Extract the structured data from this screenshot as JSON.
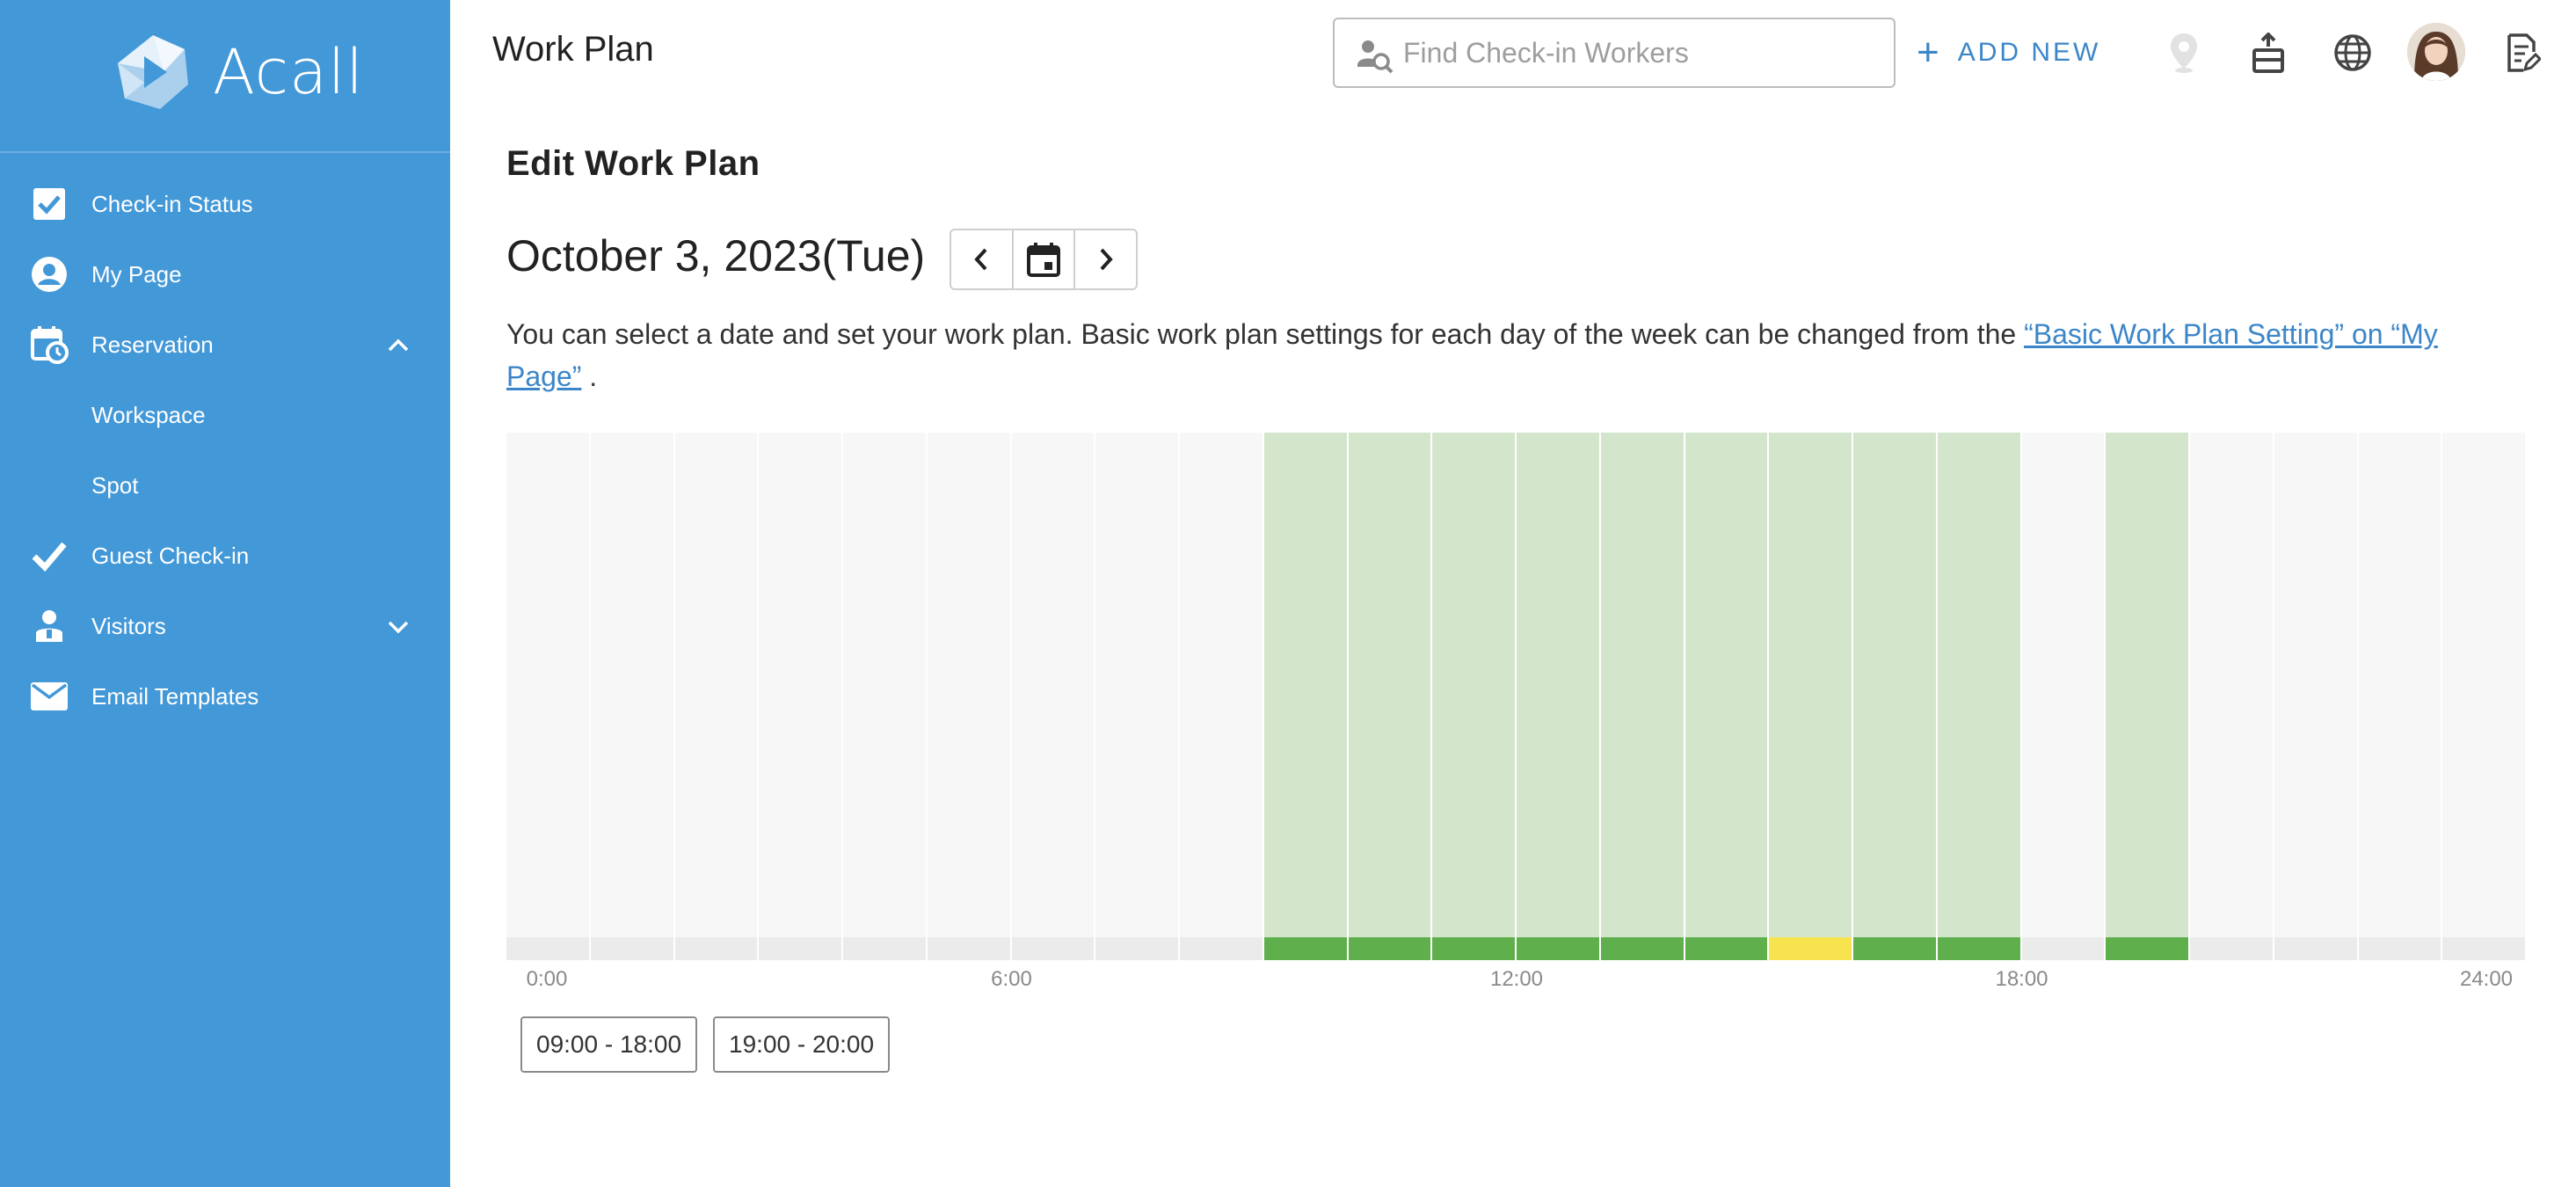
{
  "app": {
    "name": "Acall"
  },
  "sidebar": {
    "items": [
      {
        "label": "Check-in Status",
        "icon": "checkbox-icon"
      },
      {
        "label": "My Page",
        "icon": "user-circle-icon"
      },
      {
        "label": "Reservation",
        "icon": "calendar-clock-icon",
        "expanded": true
      },
      {
        "label": "Workspace",
        "icon": ""
      },
      {
        "label": "Spot",
        "icon": ""
      },
      {
        "label": "Guest Check-in",
        "icon": "checkmark-icon"
      },
      {
        "label": "Visitors",
        "icon": "visitor-icon",
        "expanded": false
      },
      {
        "label": "Email Templates",
        "icon": "envelope-icon"
      }
    ]
  },
  "header": {
    "title": "Work Plan",
    "search_placeholder": "Find Check-in Workers",
    "add_new_label": "ADD NEW",
    "icons": [
      "location-pin-icon",
      "inbox-tray-icon",
      "globe-icon",
      "avatar",
      "edit-document-icon"
    ]
  },
  "main": {
    "section_title": "Edit Work Plan",
    "date": "October 3, 2023(Tue)",
    "description_prefix": "You can select a date and set your work plan. Basic work plan settings for each day of the week can be changed from the ",
    "description_link": "“Basic Work Plan Setting” on “My Page”",
    "description_suffix": " .",
    "timeline": {
      "slots": [
        "",
        "",
        "",
        "",
        "",
        "",
        "",
        "",
        "",
        "planned",
        "planned",
        "planned",
        "planned",
        "planned",
        "planned",
        "planned-alt",
        "planned",
        "planned",
        "",
        "planned",
        "",
        "",
        "",
        ""
      ],
      "tick_labels": [
        {
          "hour": 0,
          "label": "0:00"
        },
        {
          "hour": 6,
          "label": "6:00"
        },
        {
          "hour": 12,
          "label": "12:00"
        },
        {
          "hour": 18,
          "label": "18:00"
        },
        {
          "hour": 24,
          "label": "24:00"
        }
      ]
    },
    "ranges": [
      "09:00 - 18:00",
      "19:00 - 20:00"
    ]
  },
  "colors": {
    "sidebar": "#4398d8",
    "accent": "#3b86c9",
    "slot_empty_upper": "#f7f7f7",
    "slot_empty_lower": "#ebebeb",
    "slot_planned_upper": "#d3e6cc",
    "slot_planned_lower": "#5faf4c",
    "slot_alt_lower": "#f7e34e"
  }
}
